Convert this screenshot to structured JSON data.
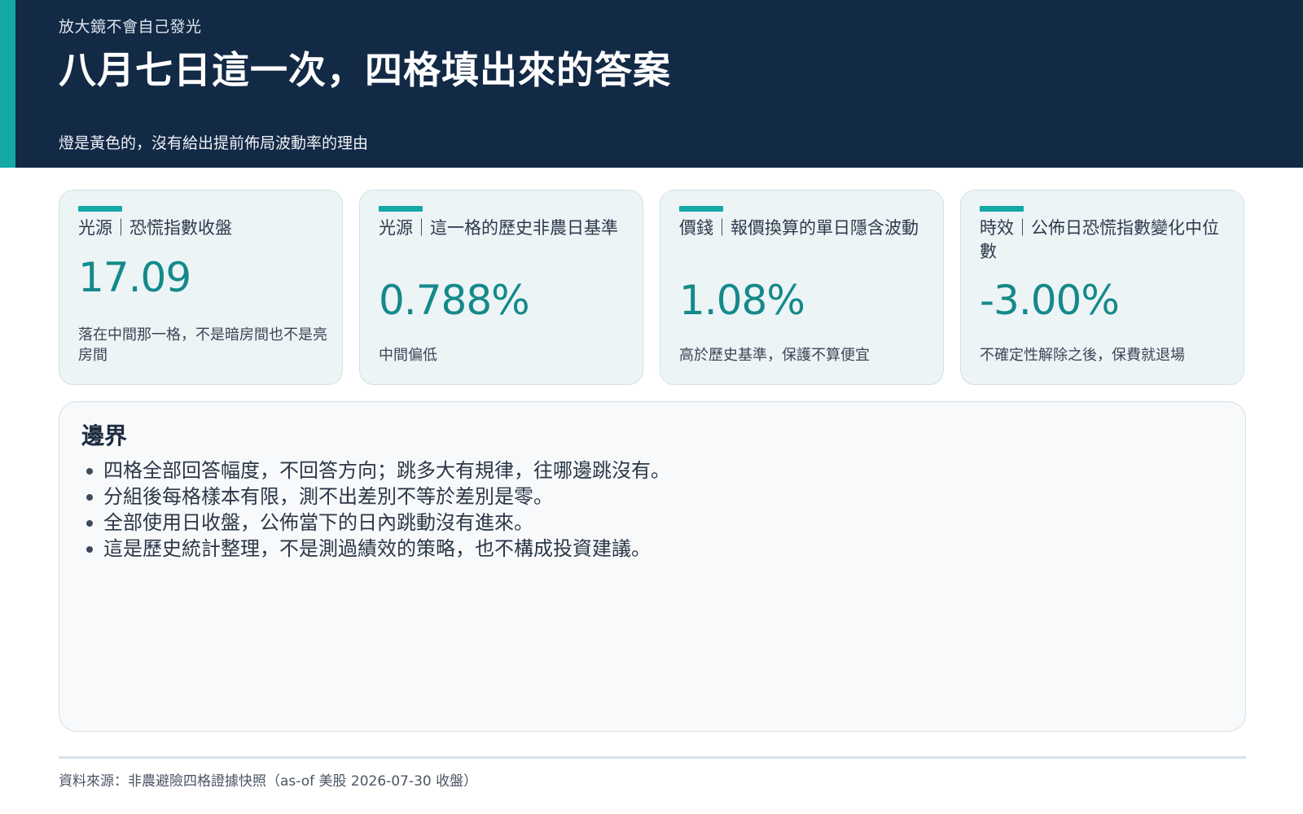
{
  "header": {
    "kicker": "放大鏡不會自己發光",
    "title": "八月七日這一次，四格填出來的答案",
    "subtitle": "燈是黃色的，沒有給出提前佈局波動率的理由"
  },
  "cards": [
    {
      "label": "光源｜恐慌指數收盤",
      "value": "17.09",
      "note": "落在中間那一格，不是暗房間也不是亮房間"
    },
    {
      "label": "光源｜這一格的歷史非農日基準",
      "value": "0.788%",
      "note": "中間偏低"
    },
    {
      "label": "價錢｜報價換算的單日隱含波動",
      "value": "1.08%",
      "note": "高於歷史基準，保護不算便宜"
    },
    {
      "label": "時效｜公佈日恐慌指數變化中位數",
      "value": "-3.00%",
      "note": "不確定性解除之後，保費就退場"
    }
  ],
  "bounds": {
    "title": "邊界",
    "items": [
      "四格全部回答幅度，不回答方向；跳多大有規律，往哪邊跳沒有。",
      "分組後每格樣本有限，測不出差別不等於差別是零。",
      "全部使用日收盤，公佈當下的日內跳動沒有進來。",
      "這是歷史統計整理，不是測過績效的策略，也不構成投資建議。"
    ]
  },
  "footer": {
    "source": "資料來源：非農避險四格證據快照（as-of 美股 2026-07-30 收盤）"
  },
  "colors": {
    "header_bg": "#132a46",
    "accent": "#14a8a6",
    "value": "#14898a",
    "card_bg": "#edf4f6"
  }
}
